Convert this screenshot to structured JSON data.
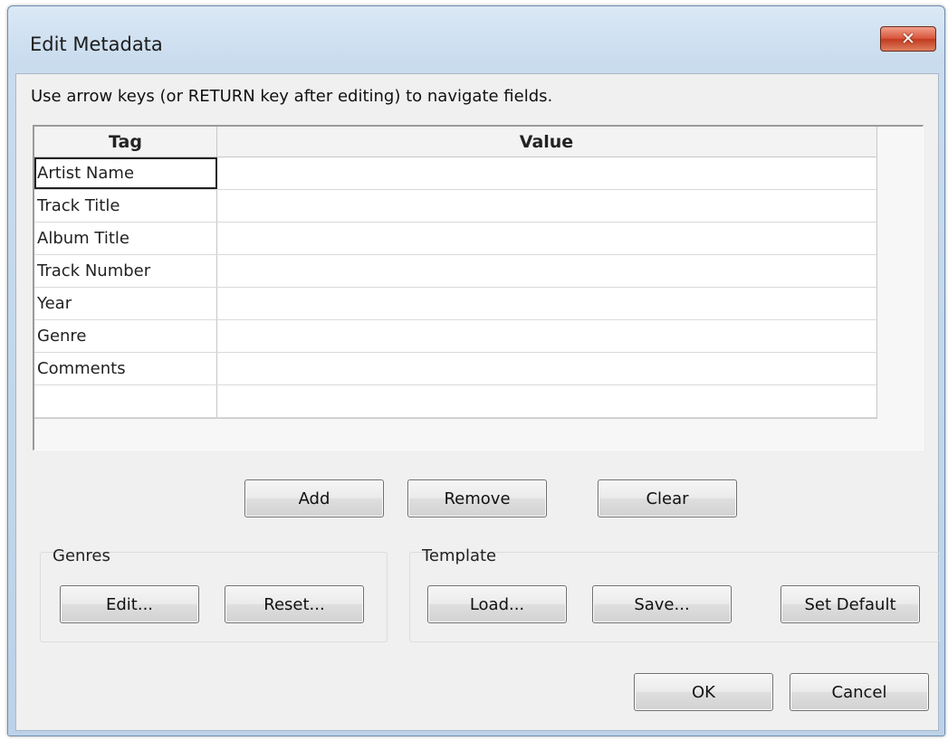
{
  "window": {
    "title": "Edit Metadata",
    "close_label": "✕"
  },
  "instruction": "Use arrow keys (or RETURN key after editing) to navigate fields.",
  "grid": {
    "columns": [
      "Tag",
      "Value"
    ],
    "rows": [
      {
        "tag": "Artist Name",
        "value": ""
      },
      {
        "tag": "Track Title",
        "value": ""
      },
      {
        "tag": "Album Title",
        "value": ""
      },
      {
        "tag": "Track Number",
        "value": ""
      },
      {
        "tag": "Year",
        "value": ""
      },
      {
        "tag": "Genre",
        "value": ""
      },
      {
        "tag": "Comments",
        "value": ""
      },
      {
        "tag": "",
        "value": ""
      }
    ],
    "selected_row": 0
  },
  "row_buttons": {
    "add": "Add",
    "remove": "Remove",
    "clear": "Clear"
  },
  "genres": {
    "label": "Genres",
    "edit": "Edit...",
    "reset": "Reset..."
  },
  "template": {
    "label": "Template",
    "load": "Load...",
    "save": "Save...",
    "set_default": "Set Default"
  },
  "dialog_buttons": {
    "ok": "OK",
    "cancel": "Cancel"
  }
}
